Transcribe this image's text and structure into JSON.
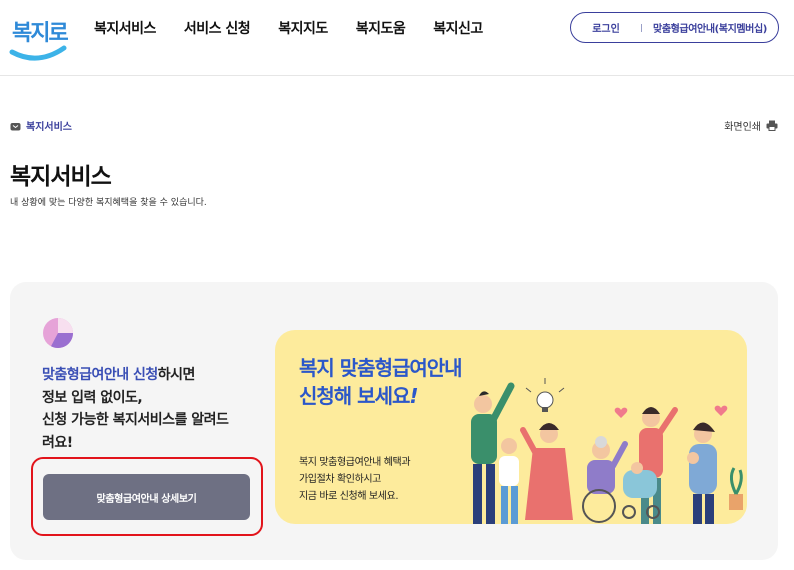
{
  "header": {
    "logo_text": "복지로",
    "nav": [
      "복지서비스",
      "서비스 신청",
      "복지지도",
      "복지도움",
      "복지신고"
    ],
    "login_label": "로그인",
    "guide_label": "맞춤형급여안내(복지멤버십)"
  },
  "breadcrumb": {
    "label": "복지서비스",
    "icon": "home-icon"
  },
  "print": {
    "label": "화면인쇄",
    "icon": "printer-icon"
  },
  "page": {
    "title": "복지서비스",
    "description": "내 상황에 맞는 다양한 복지혜택을 찾을 수 있습니다."
  },
  "promo": {
    "highlight": "맞춤형급여안내 신청",
    "line1_rest": "하시면",
    "line2": "정보 입력 없이도,",
    "line3": "신청 가능한 복지서비스를 알려드",
    "line4": "려요!",
    "button_label": "맞춤형급여안내 상세보기"
  },
  "banner": {
    "title_line1": "복지 맞춤형급여안내",
    "title_line2": "신청해 보세요",
    "title_excl": "!",
    "desc_line1": "복지 맞춤형급여안내 혜택과",
    "desc_line2": "가입절차 확인하시고",
    "desc_line3": "지금 바로 신청해 보세요."
  },
  "colors": {
    "brand": "#3a3f9c",
    "accent_blue": "#2b57c9",
    "button": "#6e7083",
    "banner_bg": "#fdeb9c",
    "focus_ring": "#e2141b"
  }
}
